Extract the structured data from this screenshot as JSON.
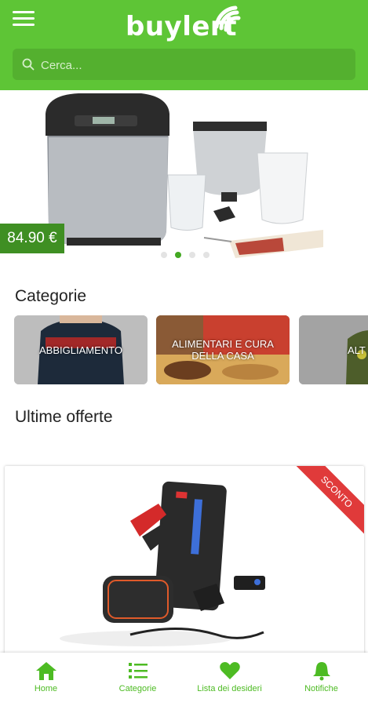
{
  "app": {
    "logo_text": "buylert"
  },
  "search": {
    "placeholder": "Cerca..."
  },
  "banner": {
    "price": "84.90 €",
    "slide_count": 4,
    "active_slide": 2
  },
  "categories": {
    "title": "Categorie",
    "items": [
      {
        "label": "ABBIGLIAMENTO"
      },
      {
        "label": "ALIMENTARI E CURA DELLA CASA"
      },
      {
        "label": "ALT"
      }
    ]
  },
  "offers": {
    "title": "Ultime offerte",
    "items": [
      {
        "badge": "SCONTO"
      }
    ]
  },
  "bottom_nav": [
    {
      "label": "Home",
      "icon": "home-icon"
    },
    {
      "label": "Categorie",
      "icon": "list-icon"
    },
    {
      "label": "Lista dei desideri",
      "icon": "heart-icon"
    },
    {
      "label": "Notifiche",
      "icon": "bell-icon"
    }
  ],
  "colors": {
    "brand_green": "#5ec536",
    "price_green": "#3f8f23",
    "ribbon_red": "#e03a3a",
    "nav_green": "#4dbb23"
  }
}
